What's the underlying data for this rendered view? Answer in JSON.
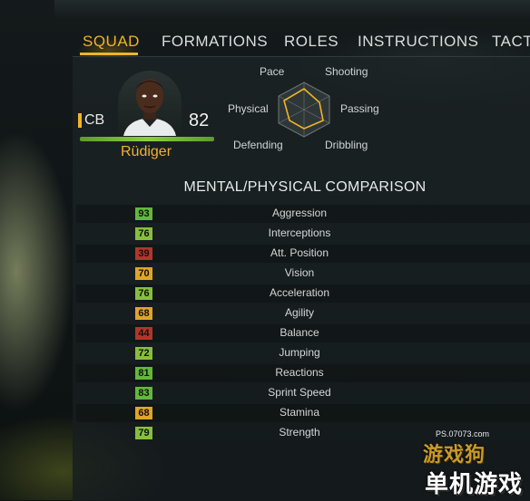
{
  "tabs": [
    {
      "label": "SQUAD",
      "active": true
    },
    {
      "label": "FORMATIONS",
      "active": false
    },
    {
      "label": "ROLES",
      "active": false
    },
    {
      "label": "INSTRUCTIONS",
      "active": false
    },
    {
      "label": "TACT",
      "active": false
    }
  ],
  "player": {
    "position": "CB",
    "rating": "82",
    "name": "Rüdiger"
  },
  "radar": {
    "labels": {
      "pace": "Pace",
      "shooting": "Shooting",
      "passing": "Passing",
      "dribbling": "Dribbling",
      "defending": "Defending",
      "physical": "Physical"
    }
  },
  "comparison": {
    "title": "MENTAL/PHYSICAL COMPARISON",
    "stats": [
      {
        "name": "Aggression",
        "value": "93",
        "color": "#62b83a"
      },
      {
        "name": "Interceptions",
        "value": "76",
        "color": "#86bf3a"
      },
      {
        "name": "Att. Position",
        "value": "39",
        "color": "#b3352a"
      },
      {
        "name": "Vision",
        "value": "70",
        "color": "#e0a526"
      },
      {
        "name": "Acceleration",
        "value": "76",
        "color": "#86bf3a"
      },
      {
        "name": "Agility",
        "value": "68",
        "color": "#e0a526"
      },
      {
        "name": "Balance",
        "value": "44",
        "color": "#b3352a"
      },
      {
        "name": "Jumping",
        "value": "72",
        "color": "#86bf3a"
      },
      {
        "name": "Reactions",
        "value": "81",
        "color": "#62b83a"
      },
      {
        "name": "Sprint Speed",
        "value": "83",
        "color": "#62b83a"
      },
      {
        "name": "Stamina",
        "value": "68",
        "color": "#e0a526"
      },
      {
        "name": "Strength",
        "value": "79",
        "color": "#86bf3a"
      }
    ]
  },
  "watermark": {
    "url": "PS.07073.com",
    "logo": "游戏狗",
    "sub": "单机游戏"
  },
  "colors": {
    "accent": "#f0b429",
    "rating_bar": "#8ccf3a"
  }
}
